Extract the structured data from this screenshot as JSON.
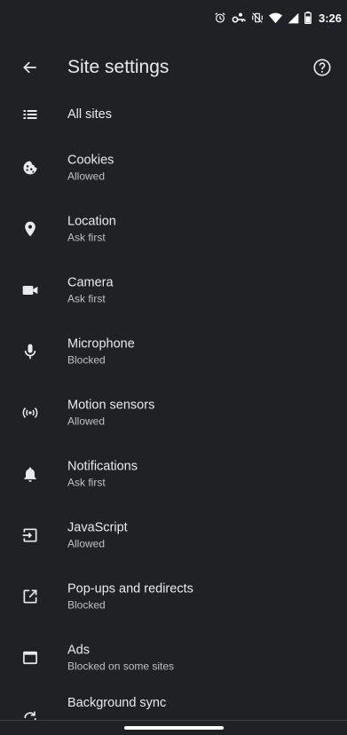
{
  "status_bar": {
    "icons": [
      "alarm-icon",
      "vpn-key-icon",
      "vibrate-off-icon",
      "wifi-icon",
      "signal-icon",
      "battery-icon"
    ],
    "time": "3:26"
  },
  "app_bar": {
    "title": "Site settings",
    "back_icon": "arrow-back-icon",
    "help_icon": "help-circle-icon"
  },
  "settings": [
    {
      "title": "All sites",
      "subtitle": "",
      "icon": "list-icon"
    },
    {
      "title": "Cookies",
      "subtitle": "Allowed",
      "icon": "cookie-icon"
    },
    {
      "title": "Location",
      "subtitle": "Ask first",
      "icon": "location-pin-icon"
    },
    {
      "title": "Camera",
      "subtitle": "Ask first",
      "icon": "videocam-icon"
    },
    {
      "title": "Microphone",
      "subtitle": "Blocked",
      "icon": "mic-icon"
    },
    {
      "title": "Motion sensors",
      "subtitle": "Allowed",
      "icon": "sensors-icon"
    },
    {
      "title": "Notifications",
      "subtitle": "Ask first",
      "icon": "bell-icon"
    },
    {
      "title": "JavaScript",
      "subtitle": "Allowed",
      "icon": "javascript-icon"
    },
    {
      "title": "Pop-ups and redirects",
      "subtitle": "Blocked",
      "icon": "open-in-new-icon"
    },
    {
      "title": "Ads",
      "subtitle": "Blocked on some sites",
      "icon": "ads-window-icon"
    },
    {
      "title": "Background sync",
      "subtitle": "",
      "icon": "sync-icon"
    }
  ],
  "colors": {
    "background": "#202124",
    "text_primary": "#e8eaed",
    "text_secondary": "#bdc1c6",
    "icon": "#e8eaed"
  }
}
